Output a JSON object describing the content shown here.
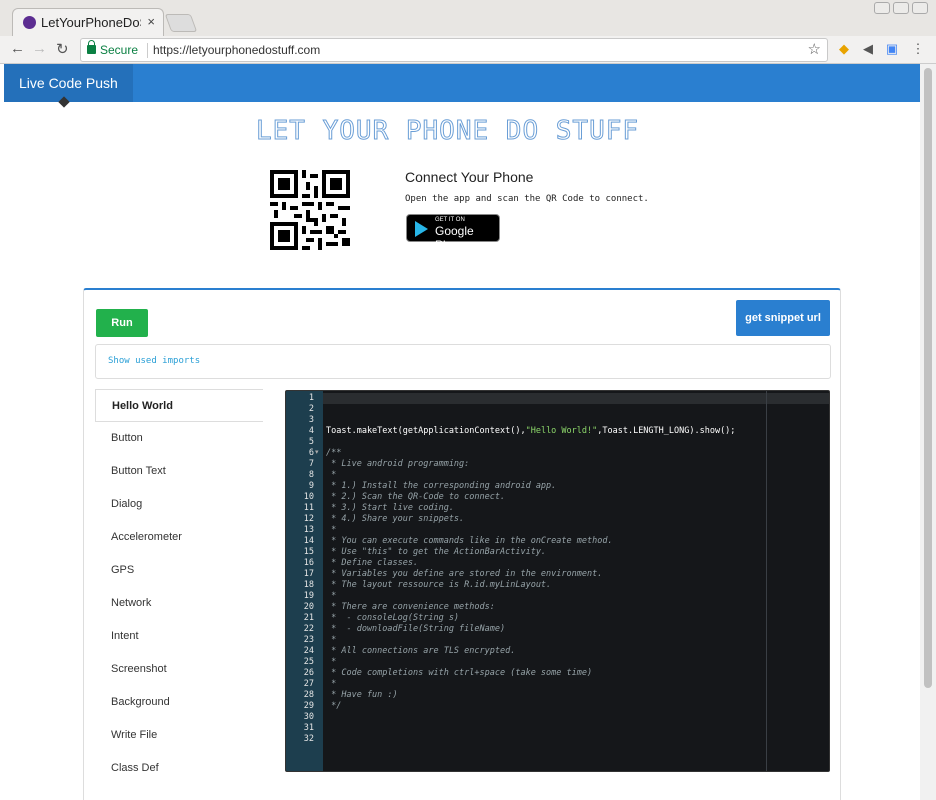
{
  "browser": {
    "tab_title": "LetYourPhoneDoSt",
    "tab_close": "×",
    "secure_label": "Secure",
    "url": "https://letyourphonedostuff.com"
  },
  "navbar": {
    "brand": "Live Code Push"
  },
  "hero": {
    "logo_text": "LET YOUR PHONE DO STUFF",
    "connect_title": "Connect Your Phone",
    "connect_text": "Open the app and scan the QR Code to connect.",
    "play_small": "GET IT ON",
    "play_big": "Google Play"
  },
  "panel": {
    "run_label": "Run",
    "snippet_label": "get snippet url",
    "imports_label": "Show used imports"
  },
  "menu": {
    "items": [
      "Hello World",
      "Button",
      "Button Text",
      "Dialog",
      "Accelerometer",
      "GPS",
      "Network",
      "Intent",
      "Screenshot",
      "Background",
      "Write File",
      "Class Def"
    ]
  },
  "editor": {
    "line_numbers": [
      "1",
      "2",
      "3",
      "4",
      "5",
      "6",
      "7",
      "8",
      "9",
      "10",
      "11",
      "12",
      "13",
      "14",
      "15",
      "16",
      "17",
      "18",
      "19",
      "20",
      "21",
      "22",
      "23",
      "24",
      "25",
      "26",
      "27",
      "28",
      "29",
      "30",
      "31",
      "32"
    ],
    "code_line4_a": "Toast.makeText(getApplicationContext(),",
    "code_line4_s": "\"Hello World!\"",
    "code_line4_b": ",Toast.LENGTH_LONG).show();",
    "comments": [
      "/**",
      " * Live android programming:",
      " *",
      " * 1.) Install the corresponding android app.",
      " * 2.) Scan the QR-Code to connect.",
      " * 3.) Start live coding.",
      " * 4.) Share your snippets.",
      " *",
      " * You can execute commands like in the onCreate method.",
      " * Use \"this\" to get the ActionBarActivity.",
      " * Define classes.",
      " * Variables you define are stored in the environment.",
      " * The layout ressource is R.id.myLinLayout.",
      " *",
      " * There are convenience methods:",
      " *  - consoleLog(String s)",
      " *  - downloadFile(String fileName)",
      " *",
      " * All connections are TLS encrypted.",
      " *",
      " * Code completions with ctrl+space (take some time)",
      " *",
      " * Have fun :)",
      " */"
    ]
  }
}
